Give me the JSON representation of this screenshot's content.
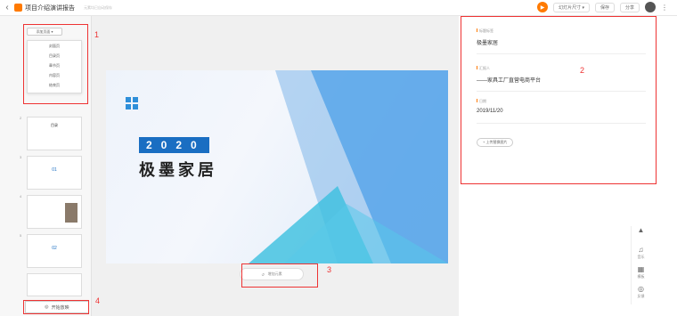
{
  "topbar": {
    "back": "‹",
    "title": "项目介绍演讲报告",
    "hint": "元素均已自动保存",
    "play_icon": "play-icon",
    "size_label": "幻灯片尺寸 ▾",
    "btn1": "保存",
    "btn2": "分享",
    "kebab": "⋮"
  },
  "left": {
    "add_label": "添加页面 ▾",
    "menu": [
      "封面页",
      "目录页",
      "章节页",
      "内容页",
      "结束页"
    ],
    "thumbs": [
      {
        "num": "1",
        "title": ""
      },
      {
        "num": "2",
        "title": "目录"
      },
      {
        "num": "3",
        "title": "01"
      },
      {
        "num": "4",
        "title": ""
      },
      {
        "num": "5",
        "title": "02"
      },
      {
        "num": "6",
        "title": ""
      }
    ],
    "start_label": "开始放映"
  },
  "slide": {
    "year": "2020",
    "brand": "极墨家居"
  },
  "canvas_tools": {
    "undo": "↺",
    "label": "增加元素"
  },
  "right": {
    "fields": [
      {
        "label": "标题标签",
        "value": "极墨家居"
      },
      {
        "label": "汇报人",
        "value": "——家具工厂直营电商平台"
      },
      {
        "label": "日期",
        "value": "2019/11/20"
      }
    ],
    "upload": "上传替换图片"
  },
  "side_tools": [
    {
      "icon": "▲",
      "label": ""
    },
    {
      "icon": "♫",
      "label": "音乐"
    },
    {
      "icon": "▦",
      "label": "模板"
    },
    {
      "icon": "◎",
      "label": "反馈"
    }
  ],
  "annotations": [
    "1",
    "2",
    "3",
    "4"
  ],
  "colors": {
    "accent": "#ff7a00",
    "annotation": "#e33333",
    "slide_blue": "#1a6ec2"
  }
}
